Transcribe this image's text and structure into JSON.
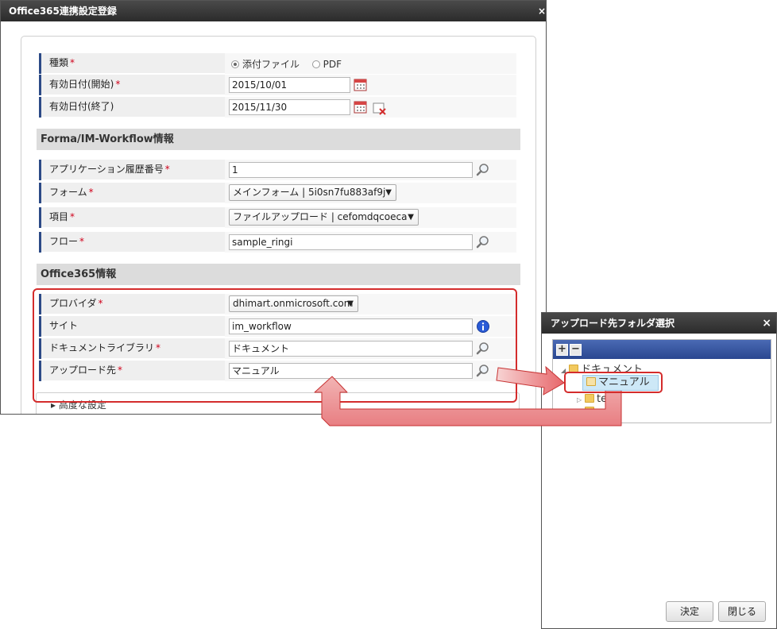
{
  "main_dialog": {
    "title": "Office365連携設定登録",
    "close_glyph": "×",
    "fields": {
      "type": {
        "label": "種類",
        "required_mark": "*",
        "options": [
          "添付ファイル",
          "PDF"
        ],
        "selected": "添付ファイル"
      },
      "start_date": {
        "label": "有効日付(開始)",
        "required_mark": "*",
        "value": "2015/10/01"
      },
      "end_date": {
        "label": "有効日付(終了)",
        "value": "2015/11/30"
      }
    },
    "sections": {
      "forma": {
        "title": "Forma/IM-Workflow情報",
        "app_history": {
          "label": "アプリケーション履歴番号",
          "required_mark": "*",
          "value": "1"
        },
        "form": {
          "label": "フォーム",
          "required_mark": "*",
          "value": "メインフォーム | 5i0sn7fu883af9j"
        },
        "item": {
          "label": "項目",
          "required_mark": "*",
          "value": "ファイルアップロード | cefomdqcoeca"
        },
        "flow": {
          "label": "フロー",
          "required_mark": "*",
          "value": "sample_ringi"
        }
      },
      "office365": {
        "title": "Office365情報",
        "provider": {
          "label": "プロバイダ",
          "required_mark": "*",
          "value": "dhimart.onmicrosoft.com"
        },
        "site": {
          "label": "サイト",
          "value": "im_workflow"
        },
        "doc_library": {
          "label": "ドキュメントライブラリ",
          "required_mark": "*",
          "value": "ドキュメント"
        },
        "upload_to": {
          "label": "アップロード先",
          "required_mark": "*",
          "value": "マニュアル"
        }
      },
      "advanced": {
        "toggle": "▸",
        "label": "高度な設定"
      }
    },
    "icons": {
      "calendar": "calendar-icon",
      "clear_date": "clear-date-icon",
      "search": "search-icon",
      "info": "info-icon",
      "dropdown": "▼"
    }
  },
  "folder_dialog": {
    "title": "アップロード先フォルダ選択",
    "close_glyph": "×",
    "toolbar": {
      "expand_all": "+",
      "collapse_all": "−"
    },
    "tree": {
      "root": {
        "label": "ドキュメント",
        "toggle": "◢"
      },
      "selected": {
        "label": "マニュアル"
      },
      "child2": {
        "label": "te",
        "toggle": "▷"
      },
      "child3": {
        "label": "",
        "toggle": "▷"
      }
    },
    "buttons": {
      "ok": "決定",
      "close": "閉じる"
    }
  },
  "colors": {
    "title_bar": "#333333",
    "section_accent": "#2c4a86",
    "highlight": "#d42c2c",
    "required": "#d0021b",
    "tree_toolbar": "#2f4e9a",
    "selected_node": "#cde8f7"
  }
}
